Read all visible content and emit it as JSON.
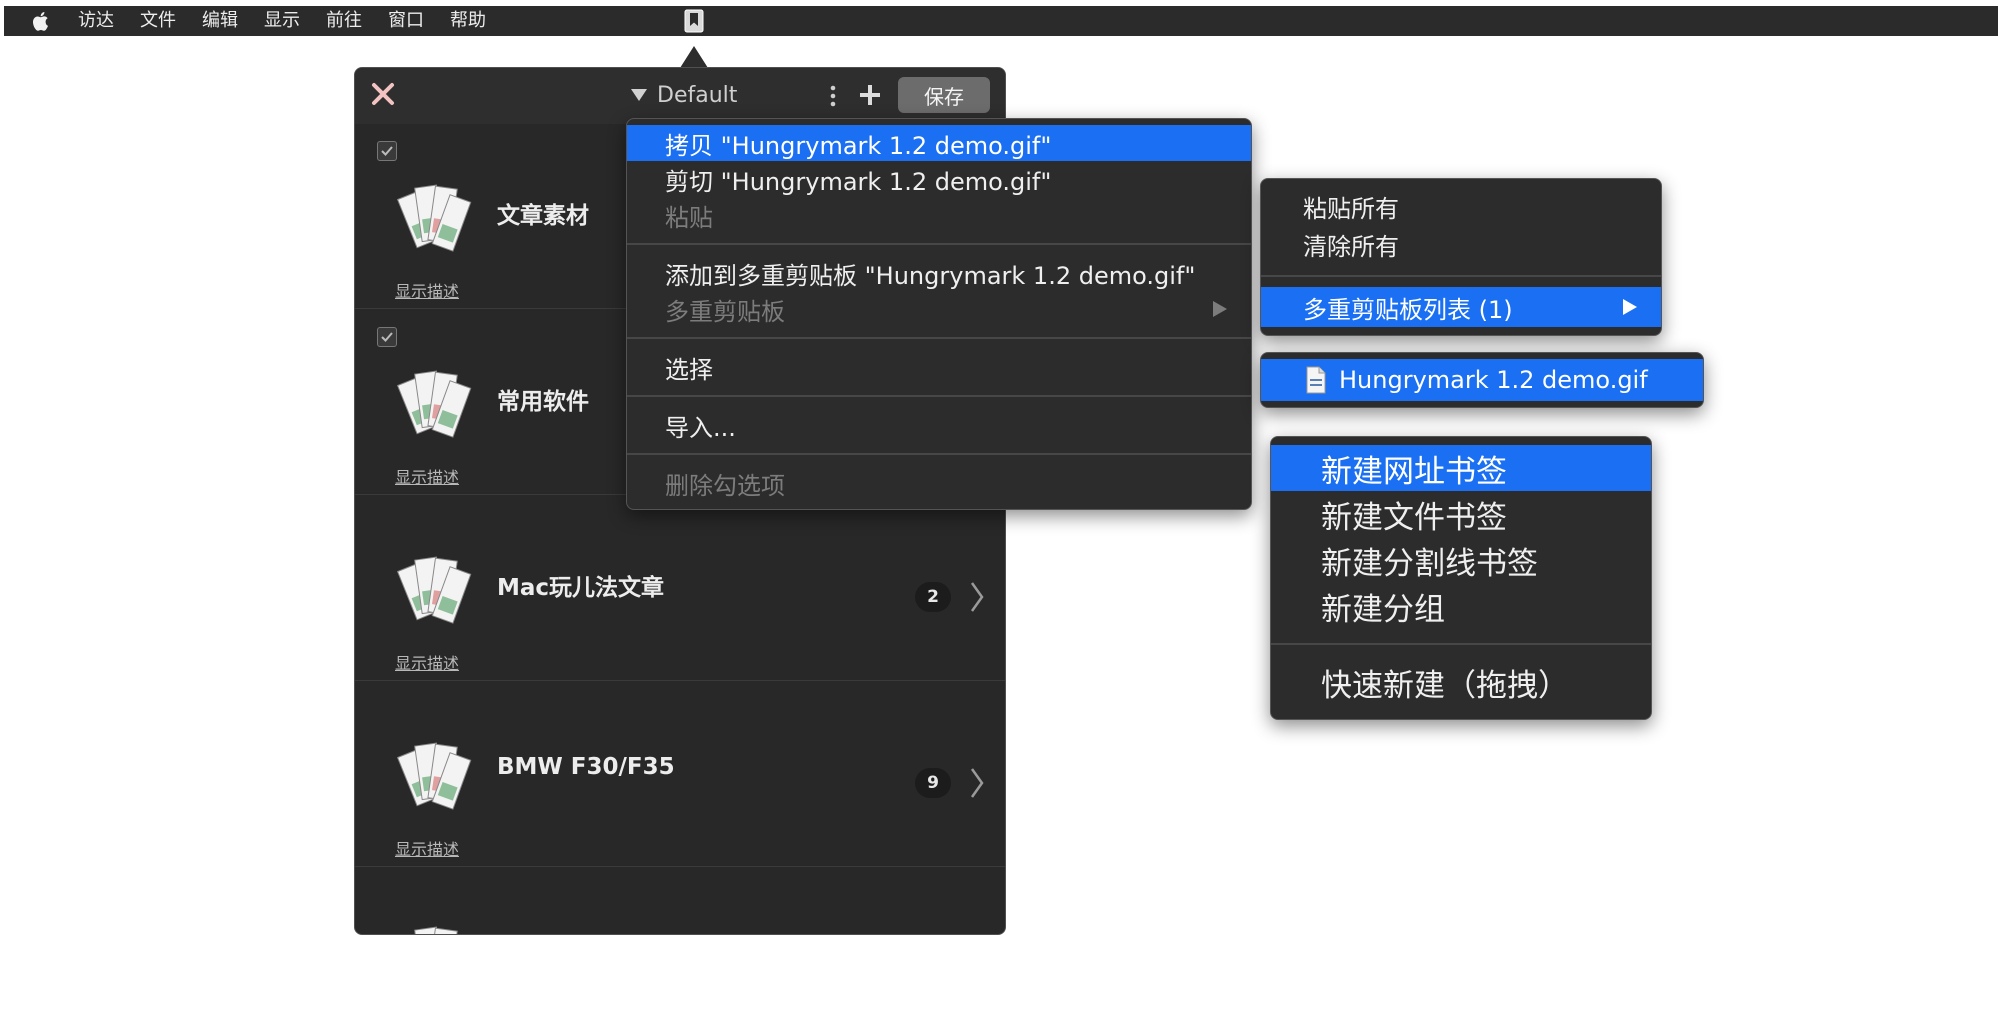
{
  "menubar": {
    "items": [
      "访达",
      "文件",
      "编辑",
      "显示",
      "前往",
      "窗口",
      "帮助"
    ]
  },
  "panel": {
    "group_name": "Default",
    "save_label": "保存",
    "rows": [
      {
        "title": "文章素材",
        "desc": "显示描述",
        "count": ""
      },
      {
        "title": "常用软件",
        "desc": "显示描述",
        "count": ""
      },
      {
        "title": "Mac玩儿法文章",
        "desc": "显示描述",
        "count": "2"
      },
      {
        "title": "BMW F30/F35",
        "desc": "显示描述",
        "count": "9"
      }
    ]
  },
  "context_menu": {
    "copy": "拷贝 \"Hungrymark 1.2 demo.gif\"",
    "cut": "剪切 \"Hungrymark 1.2 demo.gif\"",
    "paste": "粘贴",
    "add_to_clipboard": "添加到多重剪贴板 \"Hungrymark 1.2 demo.gif\"",
    "multi_clipboard": "多重剪贴板",
    "select": "选择",
    "import": "导入...",
    "delete_checked": "删除勾选项"
  },
  "clipboard_menu": {
    "paste_all": "粘贴所有",
    "clear_all": "清除所有",
    "list": "多重剪贴板列表 (1)"
  },
  "clipboard_file": {
    "name": "Hungrymark 1.2 demo.gif"
  },
  "new_menu": {
    "new_url": "新建网址书签",
    "new_file": "新建文件书签",
    "new_separator": "新建分割线书签",
    "new_group": "新建分组",
    "quick_new": "快速新建（拖拽）"
  },
  "colors": {
    "highlight": "#1a6ff2",
    "menu_bg": "#2c2c2c",
    "panel_bg": "#282828",
    "close_x": "#f3c2c2"
  }
}
